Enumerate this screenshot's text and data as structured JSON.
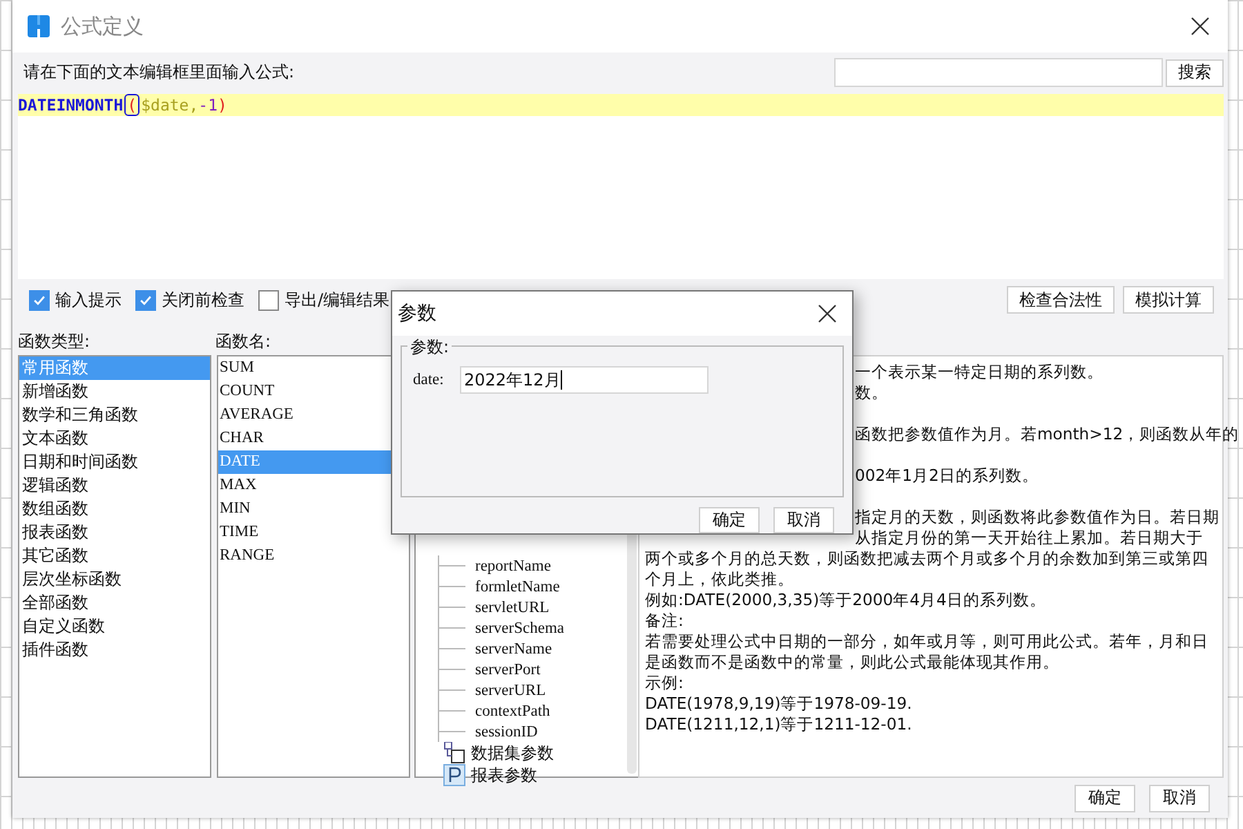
{
  "window": {
    "title": "公式定义"
  },
  "formula_label": "请在下面的文本编辑框里面输入公式:",
  "search": {
    "button": "搜索"
  },
  "editor": {
    "tokens": [
      {
        "kind": "function",
        "text": "DATEINMONTH",
        "boxed": false
      },
      {
        "kind": "paren",
        "text": "(",
        "boxed": true
      },
      {
        "kind": "variable",
        "text": "$date,",
        "boxed": false
      },
      {
        "kind": "number",
        "text": "-1",
        "boxed": false
      },
      {
        "kind": "paren",
        "text": ")",
        "boxed": false
      }
    ]
  },
  "options": [
    {
      "label": "输入提示",
      "checked": true
    },
    {
      "label": "关闭前检查",
      "checked": true
    },
    {
      "label": "导出/编辑结果",
      "checked": false
    }
  ],
  "actions": [
    "检查合法性",
    "模拟计算"
  ],
  "function_types": {
    "label": "函数类型:",
    "items": [
      {
        "label": "常用函数",
        "selected": true
      },
      {
        "label": "新增函数",
        "selected": false
      },
      {
        "label": "数学和三角函数",
        "selected": false
      },
      {
        "label": "文本函数",
        "selected": false
      },
      {
        "label": "日期和时间函数",
        "selected": false
      },
      {
        "label": "逻辑函数",
        "selected": false
      },
      {
        "label": "数组函数",
        "selected": false
      },
      {
        "label": "报表函数",
        "selected": false
      },
      {
        "label": "其它函数",
        "selected": false
      },
      {
        "label": "层次坐标函数",
        "selected": false
      },
      {
        "label": "全部函数",
        "selected": false
      },
      {
        "label": "自定义函数",
        "selected": false
      },
      {
        "label": "插件函数",
        "selected": false
      }
    ]
  },
  "function_names": {
    "label": "函数名:",
    "items": [
      {
        "label": "SUM",
        "selected": false
      },
      {
        "label": "COUNT",
        "selected": false
      },
      {
        "label": "AVERAGE",
        "selected": false
      },
      {
        "label": "CHAR",
        "selected": false
      },
      {
        "label": "DATE",
        "selected": true
      },
      {
        "label": "MAX",
        "selected": false
      },
      {
        "label": "MIN",
        "selected": false
      },
      {
        "label": "TIME",
        "selected": false
      },
      {
        "label": "RANGE",
        "selected": false
      }
    ]
  },
  "parameter_tree": {
    "items": [
      {
        "kind": "leaf",
        "label": "reportName"
      },
      {
        "kind": "leaf",
        "label": "formletName"
      },
      {
        "kind": "leaf",
        "label": "servletURL"
      },
      {
        "kind": "leaf",
        "label": "serverSchema"
      },
      {
        "kind": "leaf",
        "label": "serverName"
      },
      {
        "kind": "leaf",
        "label": "serverPort"
      },
      {
        "kind": "leaf",
        "label": "serverURL"
      },
      {
        "kind": "leaf",
        "label": "contextPath"
      },
      {
        "kind": "leaf",
        "label": "sessionID"
      },
      {
        "kind": "dataset",
        "label": "数据集参数"
      },
      {
        "kind": "report",
        "label": "报表参数"
      }
    ]
  },
  "description": {
    "partial_paragraphs": [
      [
        "一个表示某一特定日期的系列数。",
        "数。"
      ],
      [
        "函数把参数值作为月。若month>12，则函数从年的"
      ],
      [
        "002年1月2日的系列数。"
      ],
      [
        "指定月的天数，则函数将此参数值作为日。若日期",
        "从指定月份的第一天开始往上累加。若日期大于"
      ]
    ],
    "lines": [
      "两个或多个月的总天数，则函数把减去两个月或多个月的余数加到第三或第四",
      "个月上，依此类推。",
      "例如:DATE(2000,3,35)等于2000年4月4日的系列数。",
      "备注:",
      "若需要处理公式中日期的一部分，如年或月等，则可用此公式。若年，月和日",
      "是函数而不是函数中的常量，则此公式最能体现其作用。",
      "示例:",
      "DATE(1978,9,19)等于1978-09-19.",
      "DATE(1211,12,1)等于1211-12-01."
    ]
  },
  "buttons": [
    "确定",
    "取消"
  ],
  "dialog": {
    "title": "参数",
    "group": "参数:",
    "field_label": "date:",
    "field_value": "2022年12月",
    "buttons": [
      "确定",
      "取消"
    ]
  }
}
